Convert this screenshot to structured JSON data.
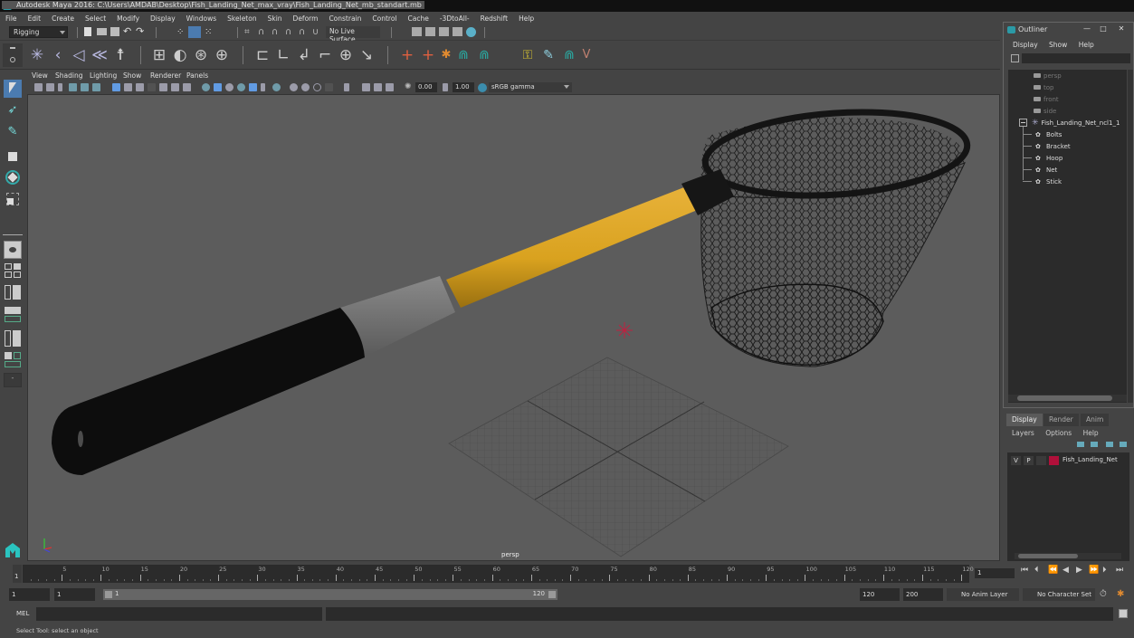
{
  "window": {
    "title": "Autodesk Maya 2016: C:\\Users\\AMDAB\\Desktop\\Fish_Landing_Net_max_vray\\Fish_Landing_Net_mb_standart.mb"
  },
  "menubar": [
    "File",
    "Edit",
    "Create",
    "Select",
    "Modify",
    "Display",
    "Windows",
    "Skeleton",
    "Skin",
    "Deform",
    "Constrain",
    "Control",
    "Cache",
    "-3DtoAll-",
    "Redshift",
    "Help"
  ],
  "statusline": {
    "mode": "Rigging",
    "live_surface": "No Live Surface"
  },
  "viewport": {
    "menu": [
      "View",
      "Shading",
      "Lighting",
      "Show",
      "Renderer",
      "Panels"
    ],
    "exposure": "0.00",
    "gamma": "1.00",
    "color_space": "sRGB gamma",
    "camera_label": "persp",
    "colors": {
      "background": "#5c5c5c",
      "handle_yellow": "#d9a21f",
      "grip_black": "#0d0d0d",
      "collar_gray": "#7a7a7a"
    }
  },
  "outliner": {
    "title": "Outliner",
    "menu": [
      "Display",
      "Show",
      "Help"
    ],
    "cameras": [
      "persp",
      "top",
      "front",
      "side"
    ],
    "group": "Fish_Landing_Net_ncl1_1",
    "children": [
      "Bolts",
      "Bracket",
      "Hoop",
      "Net",
      "Stick"
    ]
  },
  "layers": {
    "tabs": [
      "Display",
      "Render",
      "Anim"
    ],
    "active_tab": "Display",
    "menu": [
      "Layers",
      "Options",
      "Help"
    ],
    "rows": [
      {
        "v": "V",
        "p": "P",
        "name": "Fish_Landing_Net",
        "color": "#b0103a"
      }
    ]
  },
  "timeline": {
    "ticks": [
      5,
      10,
      15,
      20,
      25,
      30,
      35,
      40,
      45,
      50,
      55,
      60,
      65,
      70,
      75,
      80,
      85,
      90,
      95,
      100,
      105,
      110,
      115,
      120
    ],
    "current_frame_marker": "1",
    "current_frame_field": "1"
  },
  "range": {
    "start": "1",
    "playback_start": "1",
    "slider_start": "1",
    "slider_end": "120",
    "playback_end": "120",
    "end": "200",
    "anim_layer": "No Anim Layer",
    "character_set": "No Character Set"
  },
  "cmdline": {
    "label": "MEL"
  },
  "helpline": {
    "text": "Select Tool: select an object"
  }
}
